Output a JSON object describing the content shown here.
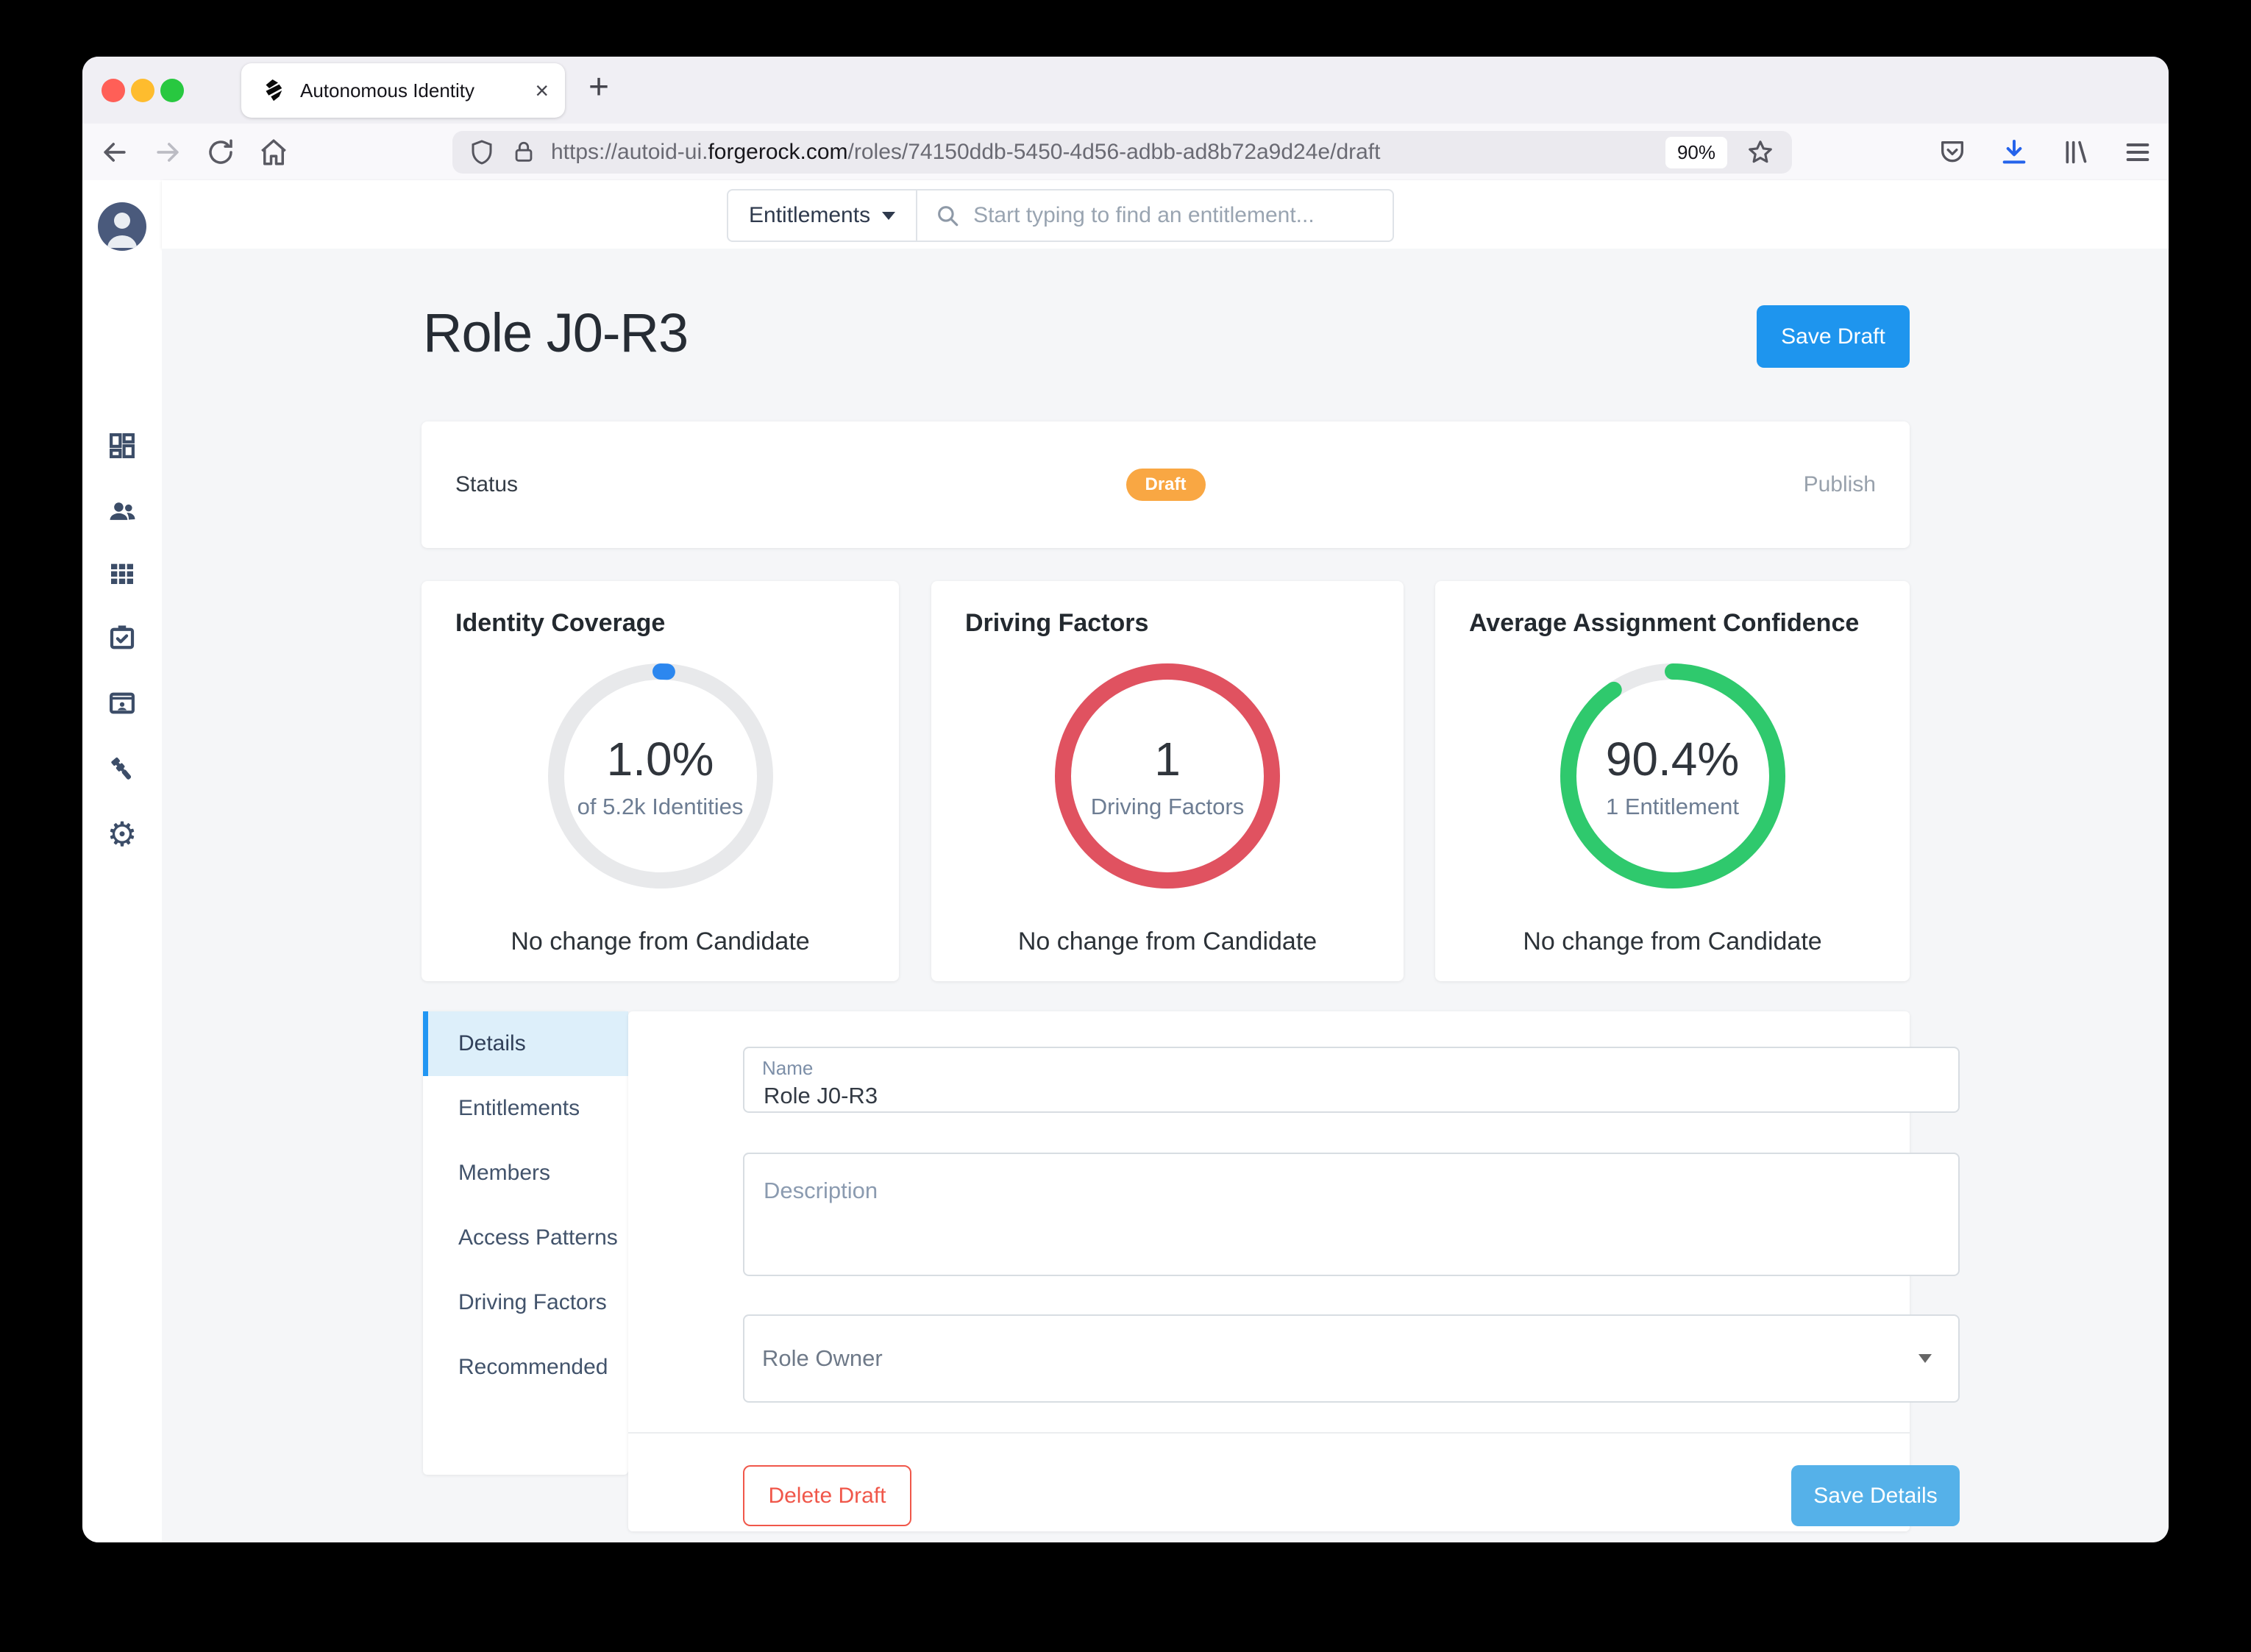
{
  "browser": {
    "tab_title": "Autonomous Identity",
    "close_glyph": "×",
    "new_tab_glyph": "+",
    "url_prefix": "https://autoid-ui.",
    "url_domain": "forgerock.com",
    "url_path": "/roles/74150ddb-5450-4d56-adbb-ad8b72a9d24e/draft",
    "zoom_badge": "90%"
  },
  "app": {
    "nav": {
      "dropdown_label": "Entitlements",
      "search_placeholder": "Start typing to find an entitlement..."
    },
    "header": {
      "title": "Role J0-R3",
      "save_draft": "Save Draft"
    },
    "status": {
      "label": "Status",
      "badge": "Draft",
      "publish": "Publish"
    },
    "cards": [
      {
        "title": "Identity Coverage",
        "value": "1.0%",
        "sub": "of 5.2k Identities",
        "note": "No change from Candidate",
        "percent": 1,
        "ring_color": "#2c87ef"
      },
      {
        "title": "Driving Factors",
        "value": "1",
        "sub": "Driving Factors",
        "note": "No change from Candidate",
        "percent": 100,
        "ring_color": "#e05260"
      },
      {
        "title": "Average Assignment Confidence",
        "value": "90.4%",
        "sub": "1 Entitlement",
        "note": "No change from Candidate",
        "percent": 90.4,
        "ring_color": "#2fc96d"
      }
    ],
    "tabs": [
      {
        "label": "Details"
      },
      {
        "label": "Entitlements"
      },
      {
        "label": "Members"
      },
      {
        "label": "Access Patterns"
      },
      {
        "label": "Driving Factors"
      },
      {
        "label": "Recommended"
      }
    ],
    "form": {
      "name_label": "Name",
      "name_value": "Role J0-R3",
      "description_placeholder": "Description",
      "role_owner_label": "Role Owner",
      "delete_draft": "Delete Draft",
      "save_details": "Save Details"
    }
  }
}
